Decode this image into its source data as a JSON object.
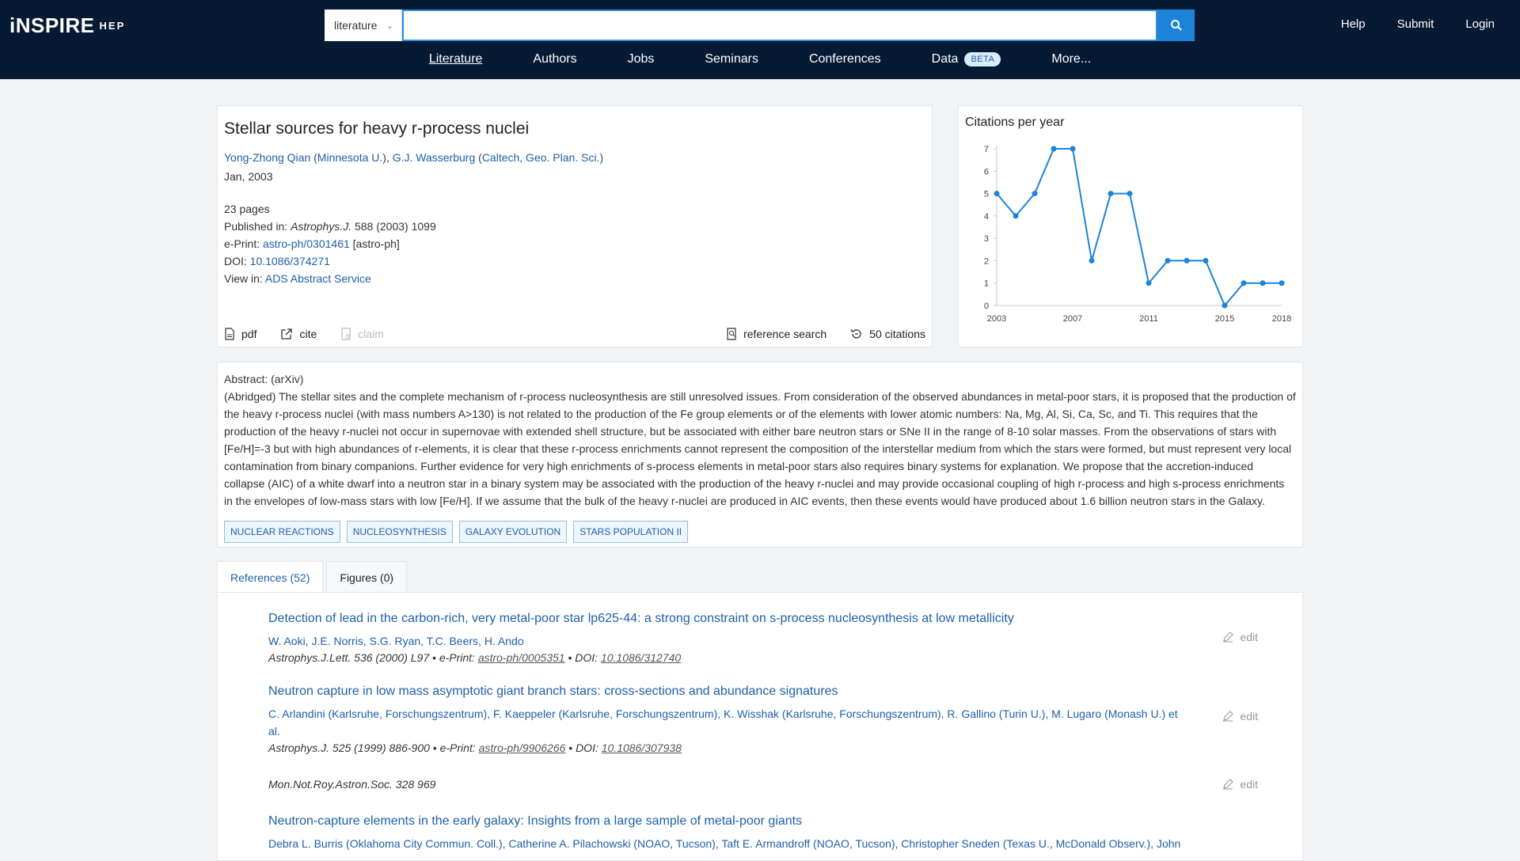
{
  "header": {
    "logo_main": "iNSPIRE",
    "logo_sub": "HEP",
    "scope": "literature",
    "search_value": "",
    "links": [
      "Help",
      "Submit",
      "Login"
    ],
    "nav": [
      "Literature",
      "Authors",
      "Jobs",
      "Seminars",
      "Conferences",
      "Data",
      "More..."
    ],
    "beta": "BETA"
  },
  "record": {
    "title": "Stellar sources for heavy r-process nuclei",
    "authors": [
      {
        "name": "Yong-Zhong Qian",
        "affiliation": "Minnesota U."
      },
      {
        "name": "G.J. Wasserburg",
        "affiliation": "Caltech, Geo. Plan. Sci."
      }
    ],
    "date": "Jan, 2003",
    "pages": "23 pages",
    "published_label": "Published in:",
    "journal": "Astrophys.J.",
    "journal_rest": "588 (2003) 1099",
    "eprint_label": "e-Print:",
    "eprint": "astro-ph/0301461",
    "eprint_cat": "[astro-ph]",
    "doi_label": "DOI:",
    "doi": "10.1086/374271",
    "view_label": "View in:",
    "view": "ADS Abstract Service",
    "actions": {
      "pdf": "pdf",
      "cite": "cite",
      "claim": "claim",
      "reference_search": "reference search",
      "citations": "50 citations"
    }
  },
  "chart_data": {
    "type": "line",
    "title": "Citations per year",
    "x": [
      2003,
      2004,
      2005,
      2006,
      2007,
      2008,
      2009,
      2010,
      2011,
      2012,
      2013,
      2014,
      2015,
      2016,
      2017,
      2018
    ],
    "values": [
      5,
      4,
      5,
      7,
      7,
      2,
      5,
      5,
      1,
      2,
      2,
      2,
      0,
      1,
      1,
      1
    ],
    "xticks": [
      2003,
      2007,
      2011,
      2015,
      2018
    ],
    "yticks": [
      0,
      1,
      2,
      3,
      4,
      5,
      6,
      7
    ],
    "ylim": [
      0,
      7
    ],
    "color": "#1d83d8"
  },
  "abstract": {
    "label": "Abstract: (arXiv)",
    "text": "(Abridged) The stellar sites and the complete mechanism of r-process nucleosynthesis are still unresolved issues. From consideration of the observed abundances in metal-poor stars, it is proposed that the production of the heavy r-process nuclei (with mass numbers A>130) is not related to the production of the Fe group elements or of the elements with lower atomic numbers: Na, Mg, Al, Si, Ca, Sc, and Ti. This requires that the production of the heavy r-nuclei not occur in supernovae with extended shell structure, but be associated with either bare neutron stars or SNe II in the range of 8-10 solar masses. From the observations of stars with [Fe/H]=-3 but with high abundances of r-elements, it is clear that these r-process enrichments cannot represent the composition of the interstellar medium from which the stars were formed, but must represent very local contamination from binary companions. Further evidence for very high enrichments of s-process elements in metal-poor stars also requires binary systems for explanation. We propose that the accretion-induced collapse (AIC) of a white dwarf into a neutron star in a binary system may be associated with the production of the heavy r-nuclei and may provide occasional coupling of high r-process and high s-process enrichments in the envelopes of low-mass stars with low [Fe/H]. If we assume that the bulk of the heavy r-nuclei are produced in AIC events, then these events would have produced about 1.6 billion neutron stars in the Galaxy.",
    "keywords": [
      "NUCLEAR REACTIONS",
      "NUCLEOSYNTHESIS",
      "GALAXY EVOLUTION",
      "STARS POPULATION II"
    ]
  },
  "tabs": [
    "References (52)",
    "Figures (0)"
  ],
  "references": [
    {
      "title": "Detection of lead in the carbon-rich, very metal-poor star lp625-44: a strong constraint on s-process nucleosynthesis at low metallicity",
      "authors": "W. Aoki, J.E. Norris, S.G. Ryan, T.C. Beers, H. Ando",
      "pub": "Astrophys.J.Lett. 536 (2000) L97",
      "eprint": "astro-ph/0005351",
      "doi": "10.1086/312740",
      "edit": "edit"
    },
    {
      "title": "Neutron capture in low mass asymptotic giant branch stars: cross-sections and abundance signatures",
      "authors": "C. Arlandini (Karlsruhe, Forschungszentrum), F. Kaeppeler (Karlsruhe, Forschungszentrum), K. Wisshak (Karlsruhe, Forschungszentrum), R. Gallino (Turin U.), M. Lugaro (Monash U.) et al.",
      "pub": "Astrophys.J. 525 (1999) 886-900",
      "eprint": "astro-ph/9906266",
      "doi": "10.1086/307938",
      "edit": "edit"
    },
    {
      "title": "",
      "authors": "",
      "pub": "Mon.Not.Roy.Astron.Soc. 328 969",
      "eprint": "",
      "doi": "",
      "edit": "edit"
    },
    {
      "title": "Neutron-capture elements in the early galaxy: Insights from a large sample of metal-poor giants",
      "authors": "Debra L. Burris (Oklahoma City Commun. Coll.), Catherine A. Pilachowski (NOAO, Tucson), Taft E. Armandroff (NOAO, Tucson), Christopher Sneden (Texas U., McDonald Observ.), John",
      "pub": "",
      "eprint": "",
      "doi": "",
      "edit": "edit"
    }
  ],
  "labels": {
    "eprint": "e-Print:",
    "doi": "DOI:",
    "sep": "•"
  }
}
